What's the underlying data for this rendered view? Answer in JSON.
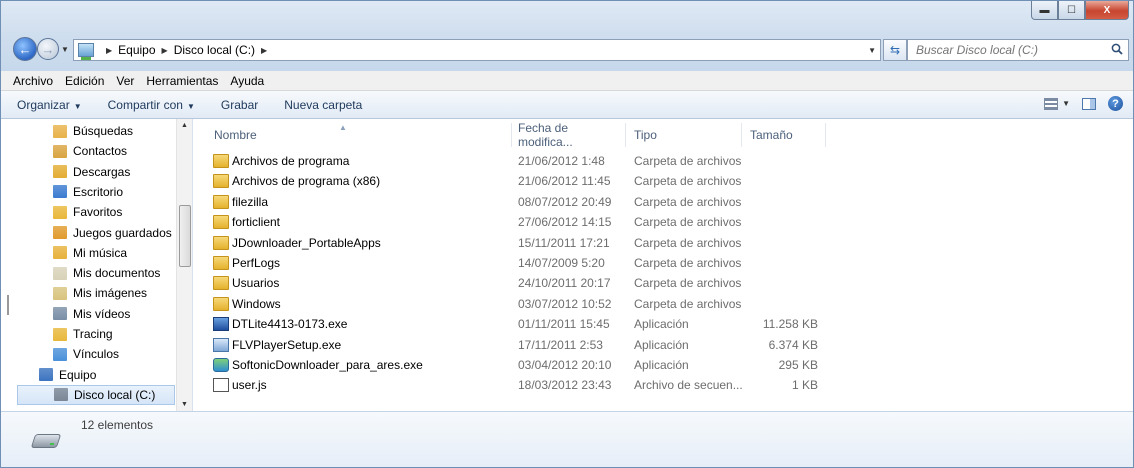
{
  "window": {
    "controls": {
      "minimize": "▬",
      "maximize": "☐",
      "close": "X"
    }
  },
  "address": {
    "crumbs": [
      "Equipo",
      "Disco local (C:)"
    ]
  },
  "search": {
    "placeholder": "Buscar Disco local (C:)"
  },
  "menu": [
    "Archivo",
    "Edición",
    "Ver",
    "Herramientas",
    "Ayuda"
  ],
  "commands": {
    "organize": "Organizar",
    "share": "Compartir con",
    "burn": "Grabar",
    "new_folder": "Nueva carpeta"
  },
  "navigation": {
    "items": [
      {
        "label": "Búsquedas",
        "icon": "search-folder-icon",
        "color": "#e8b24a"
      },
      {
        "label": "Contactos",
        "icon": "contacts-icon",
        "color": "#d9a441"
      },
      {
        "label": "Descargas",
        "icon": "downloads-icon",
        "color": "#e3ad33"
      },
      {
        "label": "Escritorio",
        "icon": "desktop-icon",
        "color": "#3b7bd0"
      },
      {
        "label": "Favoritos",
        "icon": "favorites-icon",
        "color": "#e9b73b"
      },
      {
        "label": "Juegos guardados",
        "icon": "saved-games-icon",
        "color": "#e09b2c"
      },
      {
        "label": "Mi música",
        "icon": "music-icon",
        "color": "#e7b23b"
      },
      {
        "label": "Mis documentos",
        "icon": "documents-icon",
        "color": "#d8d2b8"
      },
      {
        "label": "Mis imágenes",
        "icon": "pictures-icon",
        "color": "#d8c47e"
      },
      {
        "label": "Mis vídeos",
        "icon": "videos-icon",
        "color": "#7a8fa6"
      },
      {
        "label": "Tracing",
        "icon": "folder-icon",
        "color": "#e8b83a"
      },
      {
        "label": "Vínculos",
        "icon": "links-icon",
        "color": "#4a90d9"
      },
      {
        "label": "Equipo",
        "icon": "computer-icon",
        "color": "#3b74c0"
      },
      {
        "label": "Disco local (C:)",
        "icon": "drive-icon",
        "color": "#7c8796",
        "selected": true
      }
    ]
  },
  "columns": {
    "name": "Nombre",
    "date": "Fecha de modifica...",
    "type": "Tipo",
    "size": "Tamaño"
  },
  "files": [
    {
      "name": "Archivos de programa",
      "date": "21/06/2012 1:48",
      "type": "Carpeta de archivos",
      "size": "",
      "icon": "folder-icon"
    },
    {
      "name": "Archivos de programa (x86)",
      "date": "21/06/2012 11:45",
      "type": "Carpeta de archivos",
      "size": "",
      "icon": "folder-icon"
    },
    {
      "name": "filezilla",
      "date": "08/07/2012 20:49",
      "type": "Carpeta de archivos",
      "size": "",
      "icon": "folder-icon"
    },
    {
      "name": "forticlient",
      "date": "27/06/2012 14:15",
      "type": "Carpeta de archivos",
      "size": "",
      "icon": "folder-icon"
    },
    {
      "name": "JDownloader_PortableApps",
      "date": "15/11/2011 17:21",
      "type": "Carpeta de archivos",
      "size": "",
      "icon": "folder-icon"
    },
    {
      "name": "PerfLogs",
      "date": "14/07/2009 5:20",
      "type": "Carpeta de archivos",
      "size": "",
      "icon": "folder-icon"
    },
    {
      "name": "Usuarios",
      "date": "24/10/2011 20:17",
      "type": "Carpeta de archivos",
      "size": "",
      "icon": "folder-icon"
    },
    {
      "name": "Windows",
      "date": "03/07/2012 10:52",
      "type": "Carpeta de archivos",
      "size": "",
      "icon": "folder-icon"
    },
    {
      "name": "DTLite4413-0173.exe",
      "date": "01/11/2011 15:45",
      "type": "Aplicación",
      "size": "11.258 KB",
      "icon": "installer-icon"
    },
    {
      "name": "FLVPlayerSetup.exe",
      "date": "17/11/2011 2:53",
      "type": "Aplicación",
      "size": "6.374 KB",
      "icon": "setup-icon"
    },
    {
      "name": "SoftonicDownloader_para_ares.exe",
      "date": "03/04/2012 20:10",
      "type": "Aplicación",
      "size": "295 KB",
      "icon": "app-icon"
    },
    {
      "name": "user.js",
      "date": "18/03/2012 23:43",
      "type": "Archivo de secuen...",
      "size": "1 KB",
      "icon": "script-icon"
    }
  ],
  "details": {
    "count": "12 elementos"
  }
}
